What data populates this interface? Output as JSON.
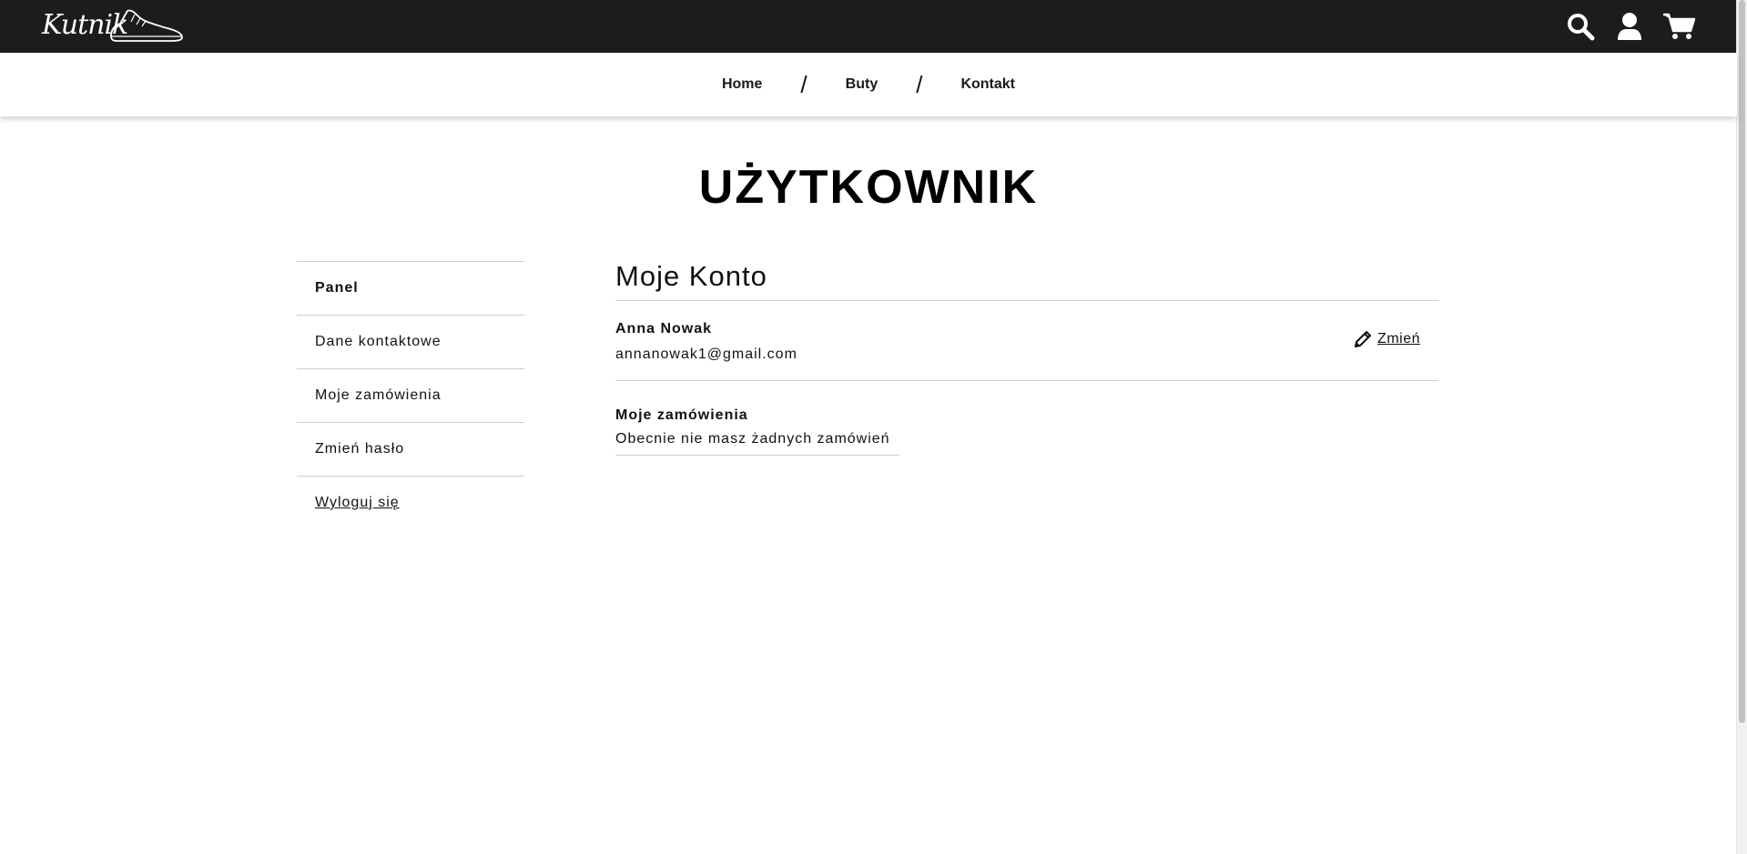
{
  "header": {
    "logo_text": "Kutnik",
    "icons": [
      "search-icon",
      "user-icon",
      "cart-icon"
    ]
  },
  "nav": {
    "items": [
      {
        "label": "Home"
      },
      {
        "label": "Buty"
      },
      {
        "label": "Kontakt"
      }
    ],
    "separator": "/"
  },
  "page_title": "UŻYTKOWNIK",
  "sidebar": {
    "items": [
      {
        "label": "Panel",
        "active": true
      },
      {
        "label": "Dane kontaktowe"
      },
      {
        "label": "Moje zamówienia"
      },
      {
        "label": "Zmień hasło"
      },
      {
        "label": "Wyloguj się"
      }
    ]
  },
  "account": {
    "heading": "Moje Konto",
    "name": "Anna Nowak",
    "email": "annanowak1@gmail.com",
    "change_label": "Zmień"
  },
  "orders": {
    "title": "Moje zamówienia",
    "empty_text": "Obecnie nie masz żadnych zamówień"
  },
  "colors": {
    "topbar": "#1c1c1c",
    "divider": "#cfcfcf",
    "text": "#111111"
  }
}
